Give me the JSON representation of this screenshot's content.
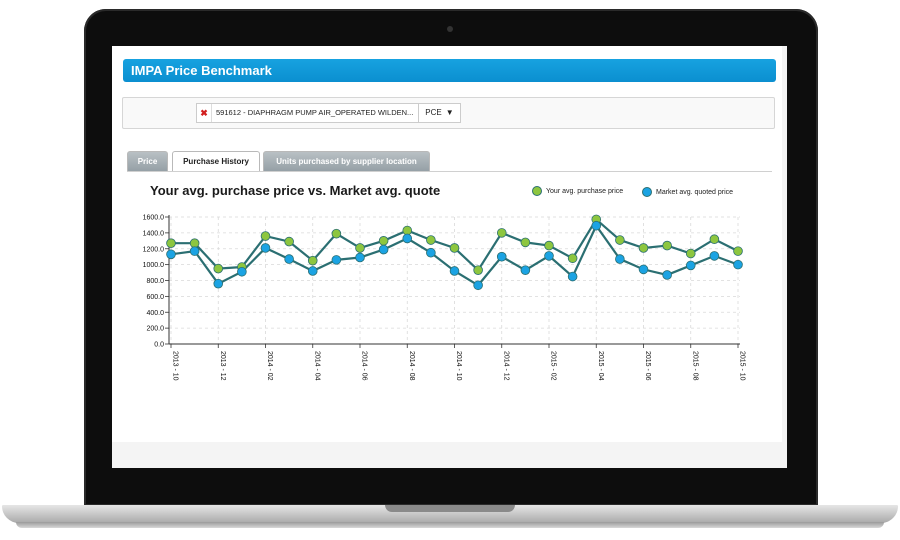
{
  "app": {
    "title": "IMPA Price Benchmark"
  },
  "filter": {
    "remove_icon": "x-icon",
    "product": "591612 - DIAPHRAGM PUMP AIR_OPERATED WILDEN...",
    "unit": "PCE",
    "unit_caret": "▼"
  },
  "tabs": [
    {
      "label": "Price",
      "active": false
    },
    {
      "label": "Purchase History",
      "active": true
    },
    {
      "label": "Units purchased by supplier location",
      "active": false
    }
  ],
  "chart": {
    "title": "Your avg. purchase price vs. Market avg. quote"
  },
  "colors": {
    "title_bar": "#17a2e0",
    "purchase_line": "#2b6f72",
    "purchase_marker": "#8dc63f",
    "market_line": "#2b6f72",
    "market_marker": "#1ba3e3"
  },
  "chart_data": {
    "type": "line",
    "title": "Your avg. purchase price vs. Market avg. quote",
    "xlabel": "",
    "ylabel": "",
    "ylim": [
      0,
      1600
    ],
    "y_ticks": [
      0.0,
      200.0,
      400.0,
      600.0,
      800.0,
      1000.0,
      1200.0,
      1400.0,
      1600.0
    ],
    "y_tick_labels": [
      "0.0",
      "200.0",
      "400.0",
      "600.0",
      "800.0",
      "1000.0",
      "1200.0",
      "1400.0",
      "1600.0"
    ],
    "x_tick_labels": [
      "2013 - 10",
      "2013 - 12",
      "2014 - 02",
      "2014 - 04",
      "2014 - 06",
      "2014 - 08",
      "2014 - 10",
      "2014 - 12",
      "2015 - 02",
      "2015 - 04",
      "2015 - 06",
      "2015 - 08",
      "2015 - 10"
    ],
    "grid": true,
    "legend_position": "top-right",
    "series": [
      {
        "name": "Your avg. purchase price",
        "values": [
          1270,
          1270,
          950,
          970,
          1360,
          1290,
          1050,
          1390,
          1210,
          1300,
          1430,
          1310,
          1210,
          930,
          1400,
          1280,
          1240,
          1080,
          1570,
          1310,
          1210,
          1240,
          1140,
          1320,
          1170
        ]
      },
      {
        "name": "Market avg. quoted price",
        "values": [
          1130,
          1170,
          760,
          910,
          1210,
          1070,
          920,
          1060,
          1090,
          1190,
          1330,
          1150,
          920,
          740,
          1100,
          930,
          1110,
          850,
          1490,
          1070,
          940,
          870,
          990,
          1110,
          1000
        ]
      }
    ]
  }
}
